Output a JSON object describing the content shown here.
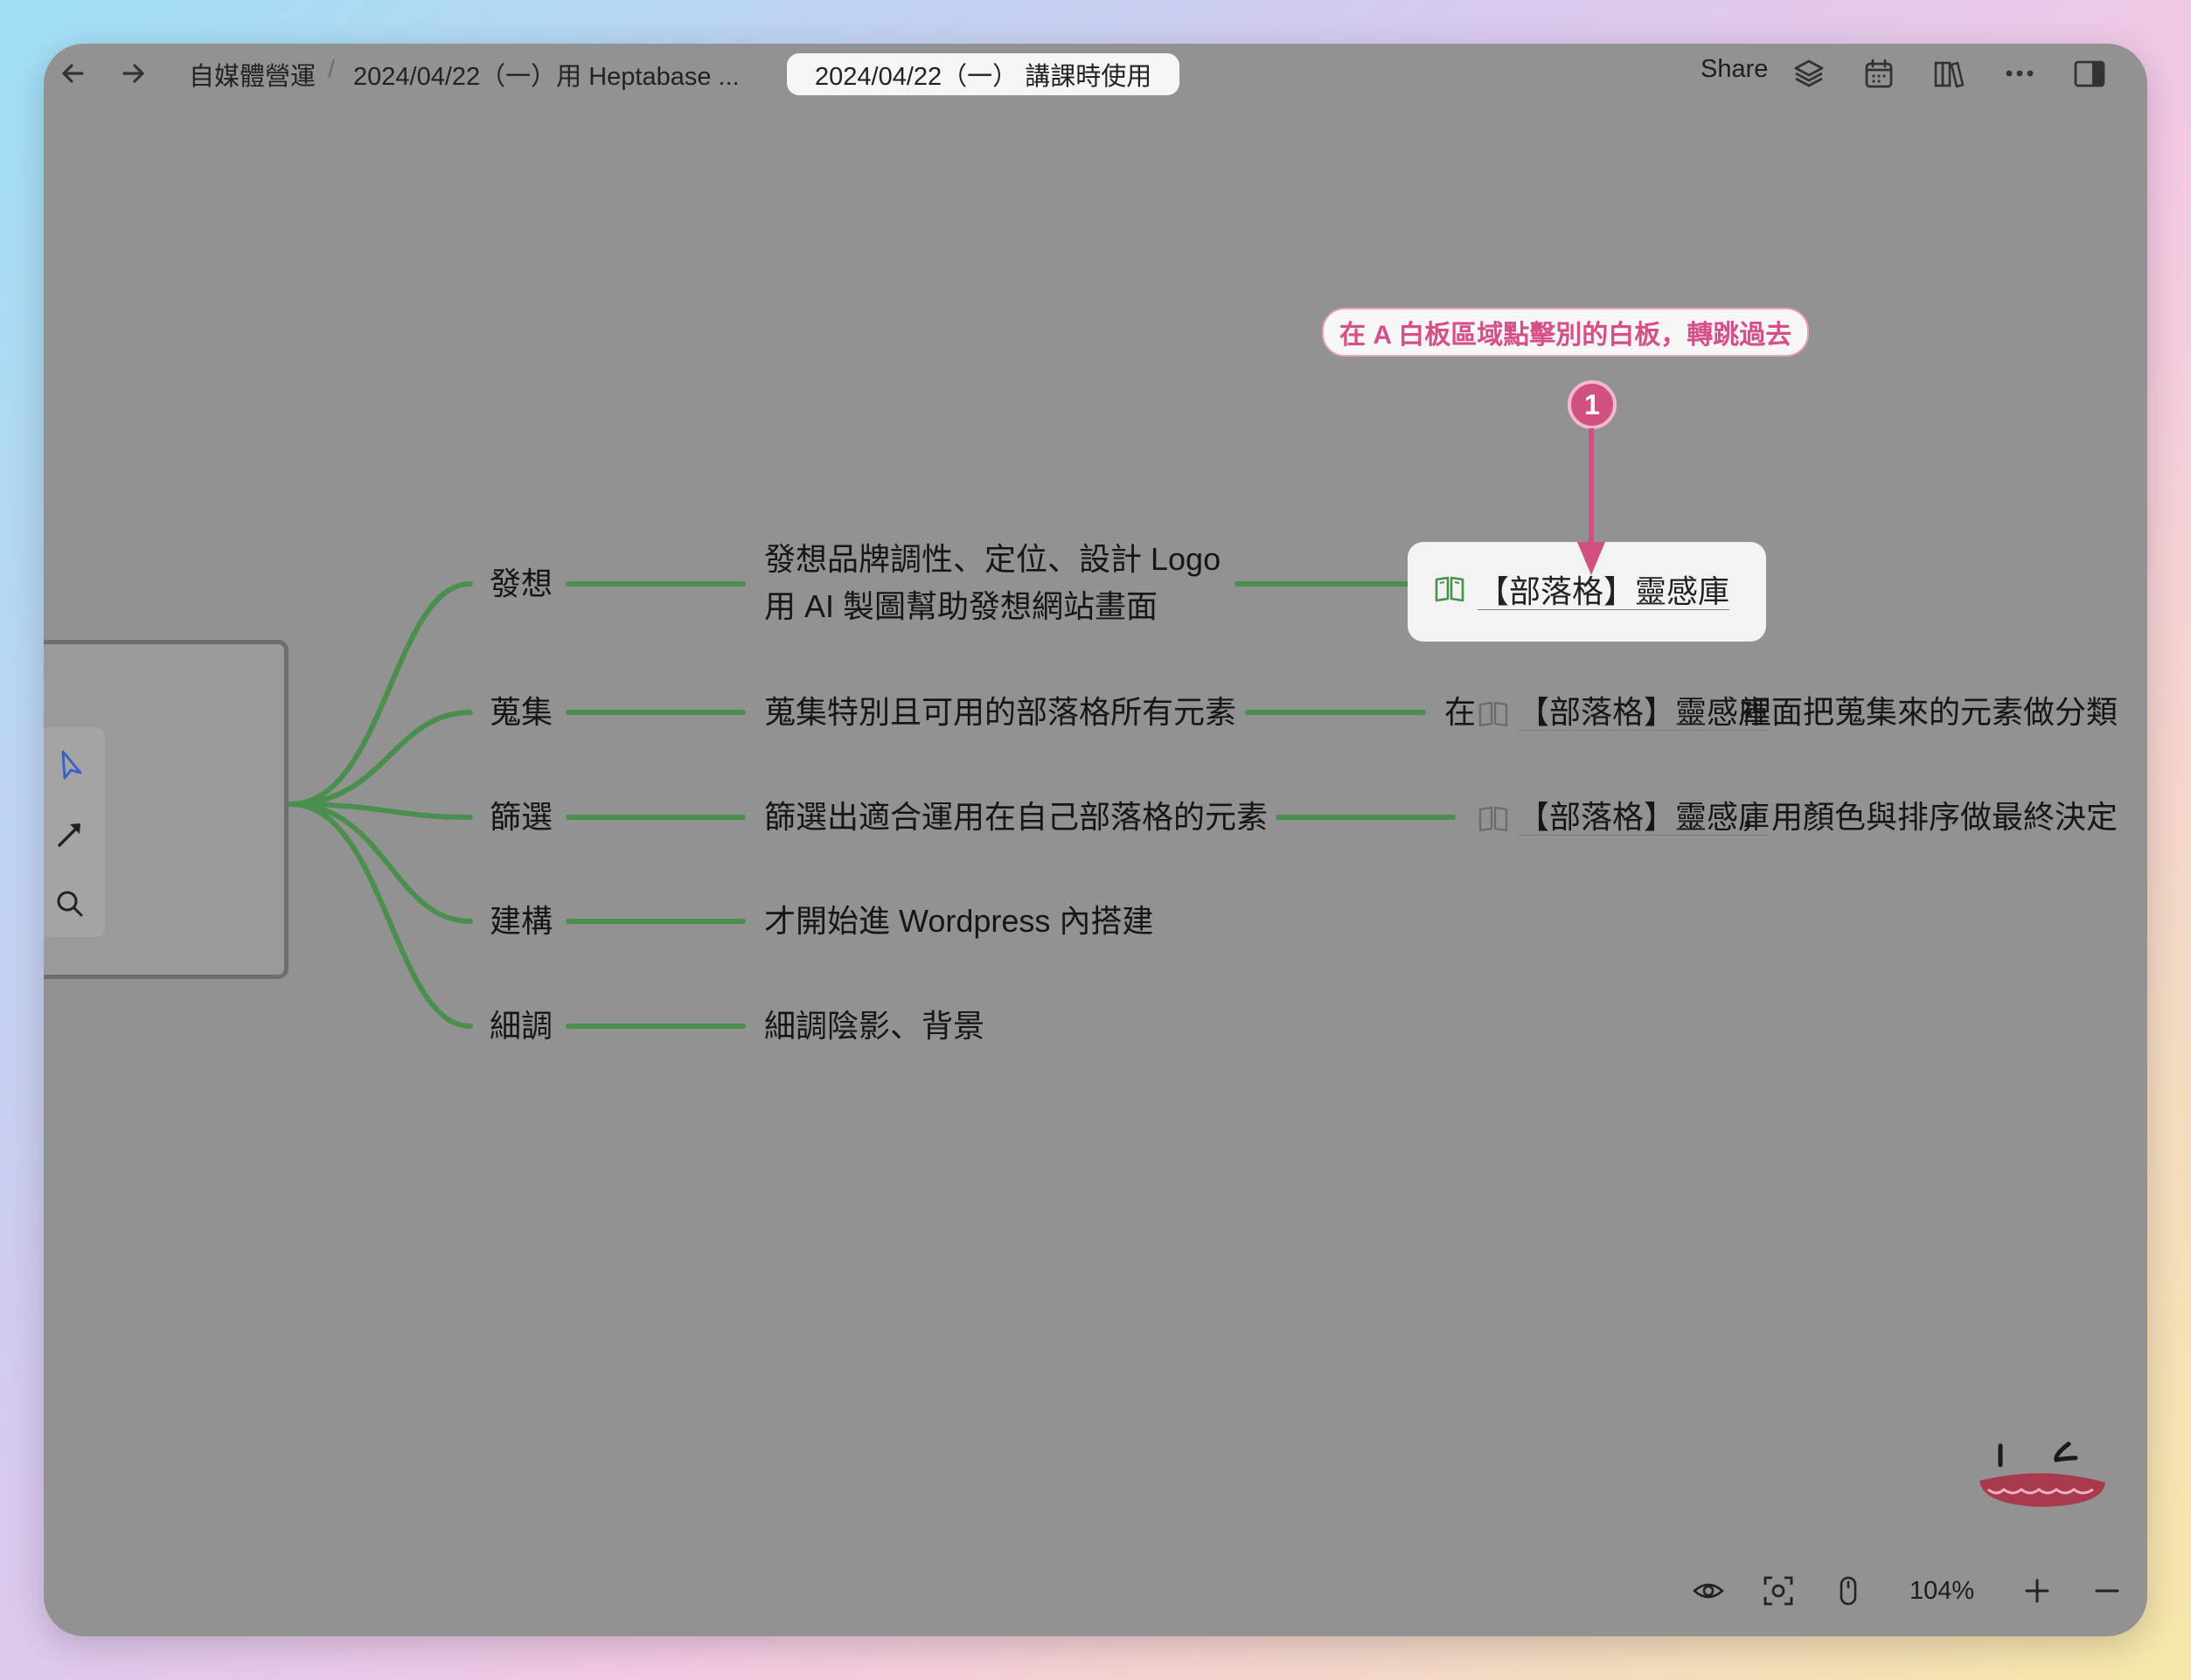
{
  "breadcrumbs": [
    "自媒體營運",
    "2024/04/22（一）用 Heptabase ...",
    "2024/04/22（一） 講課時使用"
  ],
  "topbar": {
    "share_label": "Share"
  },
  "annotation": {
    "callout": "在 A 白板區域點擊別的白板，轉跳過去",
    "badge": "1",
    "color": "#d0507f"
  },
  "mindmap": {
    "branches": [
      {
        "label": "發想",
        "detail": [
          "發想品牌調性、定位、設計 Logo",
          "用 AI 製圖幫助發想網站畫面"
        ],
        "linked_card": "【部落格】靈感庫"
      },
      {
        "label": "蒐集",
        "detail": [
          "蒐集特別且可用的部落格所有元素"
        ],
        "prefix": "在",
        "link": "【部落格】靈感庫",
        "suffix": "裡面把蒐集來的元素做分類"
      },
      {
        "label": "篩選",
        "detail": [
          "篩選出適合運用在自己部落格的元素"
        ],
        "link": "【部落格】靈感庫",
        "suffix": "，用顏色與排序做最終決定"
      },
      {
        "label": "建構",
        "detail": [
          "才開始進 Wordpress 內搭建"
        ]
      },
      {
        "label": "細調",
        "detail": [
          "細調陰影、背景"
        ]
      }
    ],
    "line_color": "#4a8f4e"
  },
  "bottombar": {
    "zoom": "104%"
  },
  "icons": [
    "back-arrow-icon",
    "forward-arrow-icon",
    "layers-icon",
    "calendar-icon",
    "library-icon",
    "more-icon",
    "sidebar-toggle-icon",
    "cursor-icon",
    "connector-icon",
    "search-icon",
    "eye-icon",
    "focus-icon",
    "mouse-icon",
    "plus-icon",
    "minus-icon",
    "book-icon"
  ]
}
